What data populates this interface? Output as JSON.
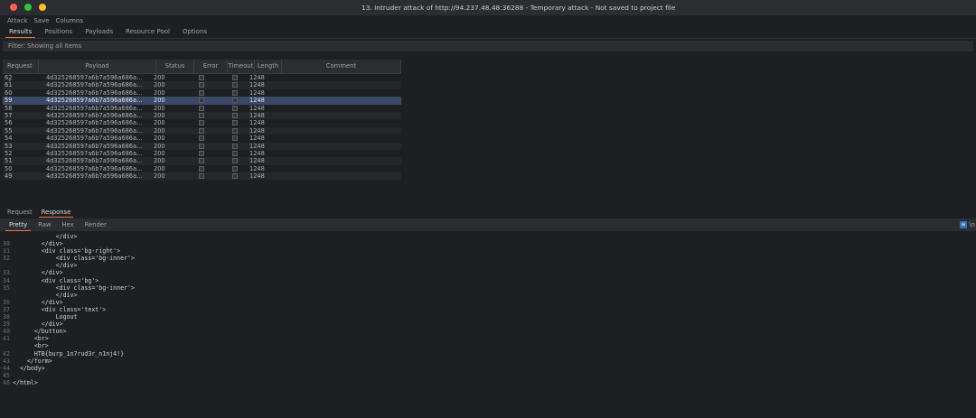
{
  "window": {
    "title": "13. Intruder attack of http://94.237.48.48:36288 - Temporary attack - Not saved to project file"
  },
  "menu": [
    "Attack",
    "Save",
    "Columns"
  ],
  "tabs": [
    "Results",
    "Positions",
    "Payloads",
    "Resource Pool",
    "Options"
  ],
  "filter": "Filter: Showing all items",
  "table": {
    "headers": {
      "request": "Request",
      "payload": "Payload",
      "status": "Status",
      "error": "Error",
      "timeout": "Timeout",
      "length": "Length",
      "comment": "Comment"
    },
    "rows": [
      {
        "request": "62",
        "payload": "4d325268597a6b7a596a686a...",
        "status": "200",
        "length": "1248"
      },
      {
        "request": "61",
        "payload": "4d325268597a6b7a596a686a...",
        "status": "200",
        "length": "1248"
      },
      {
        "request": "60",
        "payload": "4d325268597a6b7a596a686a...",
        "status": "200",
        "length": "1248"
      },
      {
        "request": "59",
        "payload": "4d325268597a6b7a596a686a...",
        "status": "200",
        "length": "1248"
      },
      {
        "request": "58",
        "payload": "4d325268597a6b7a596a686a...",
        "status": "200",
        "length": "1248"
      },
      {
        "request": "57",
        "payload": "4d325268597a6b7a596a686a...",
        "status": "200",
        "length": "1248"
      },
      {
        "request": "56",
        "payload": "4d325268597a6b7a596a686a...",
        "status": "200",
        "length": "1248"
      },
      {
        "request": "55",
        "payload": "4d325268597a6b7a596a686a...",
        "status": "200",
        "length": "1248"
      },
      {
        "request": "54",
        "payload": "4d325268597a6b7a596a686a...",
        "status": "200",
        "length": "1248"
      },
      {
        "request": "53",
        "payload": "4d325268597a6b7a596a686a...",
        "status": "200",
        "length": "1248"
      },
      {
        "request": "52",
        "payload": "4d325268597a6b7a596a686a...",
        "status": "200",
        "length": "1248"
      },
      {
        "request": "51",
        "payload": "4d325268597a6b7a596a686a...",
        "status": "200",
        "length": "1248"
      },
      {
        "request": "50",
        "payload": "4d325268597a6b7a596a686a...",
        "status": "200",
        "length": "1248"
      },
      {
        "request": "49",
        "payload": "4d325268597a6b7a596a686a...",
        "status": "200",
        "length": "1248"
      }
    ],
    "selected_index": 3
  },
  "rr_tabs": [
    "Request",
    "Response"
  ],
  "sub_tabs": [
    "Pretty",
    "Raw",
    "Hex",
    "Render"
  ],
  "wrap_label": "\\n",
  "code_lines": [
    {
      "n": "",
      "t": "            </div>"
    },
    {
      "n": "30",
      "t": "        </div>"
    },
    {
      "n": "31",
      "t": "        <div class='bg-right'>"
    },
    {
      "n": "32",
      "t": "            <div class='bg-inner'>"
    },
    {
      "n": "",
      "t": "            </div>"
    },
    {
      "n": "33",
      "t": "        </div>"
    },
    {
      "n": "34",
      "t": "        <div class='bg'>"
    },
    {
      "n": "35",
      "t": "            <div class='bg-inner'>"
    },
    {
      "n": "",
      "t": "            </div>"
    },
    {
      "n": "36",
      "t": "        </div>"
    },
    {
      "n": "37",
      "t": "        <div class='text'>"
    },
    {
      "n": "38",
      "t": "            Logout"
    },
    {
      "n": "39",
      "t": "        </div>"
    },
    {
      "n": "40",
      "t": "      </button>"
    },
    {
      "n": "41",
      "t": "      <br>"
    },
    {
      "n": "",
      "t": "      <br>"
    },
    {
      "n": "42",
      "t": "      HTB{burp_1n7rud3r_n1nj4!}"
    },
    {
      "n": "43",
      "t": "    </form>"
    },
    {
      "n": "44",
      "t": "  </body>"
    },
    {
      "n": "45",
      "t": ""
    },
    {
      "n": "46",
      "t": "</html>"
    }
  ],
  "colors": {
    "accent": "#e8793a",
    "selected_row": "#3a4a66",
    "dot_red": "#ff5f57",
    "dot_green": "#28c840",
    "dot_yellow": "#febc2e"
  }
}
